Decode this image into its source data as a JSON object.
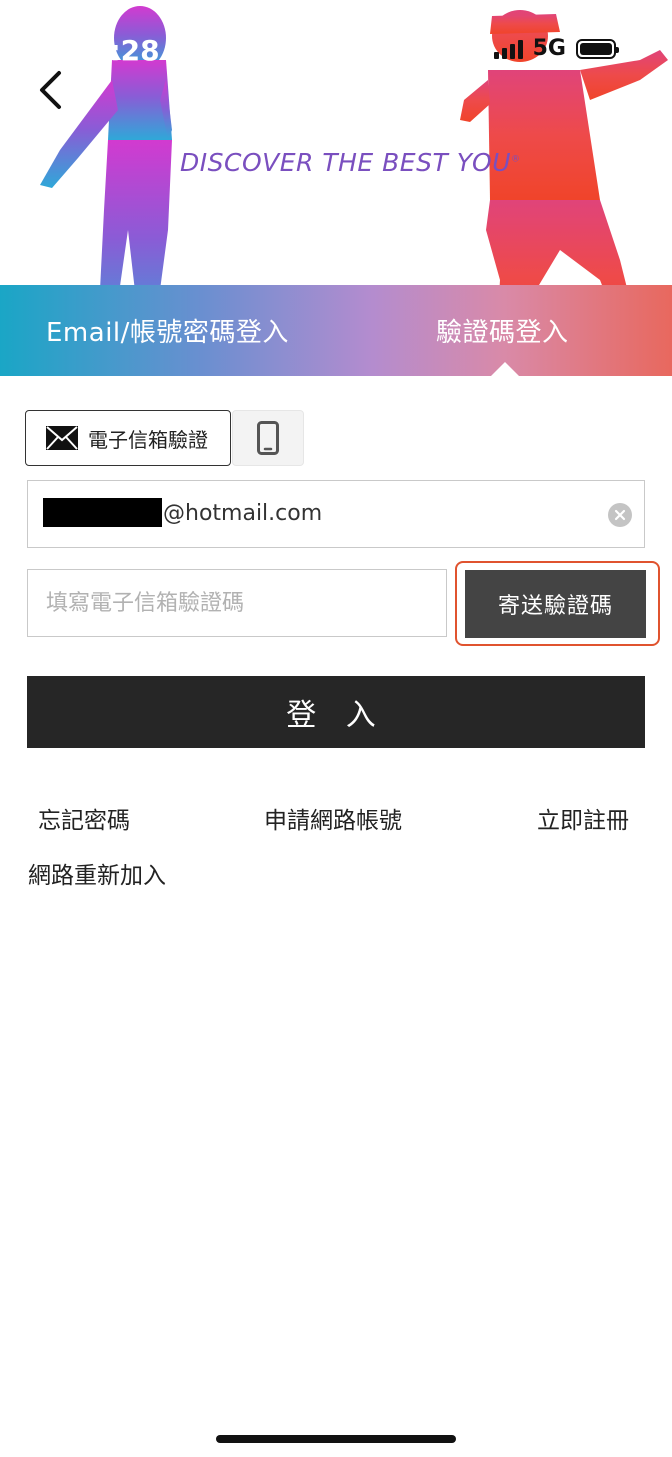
{
  "status_bar": {
    "time": "8:28",
    "network": "5G"
  },
  "header": {
    "slogan": "DISCOVER THE BEST YOU",
    "slogan_mark": "®",
    "tabs": [
      {
        "label": "Email/帳號密碼登入",
        "active": false
      },
      {
        "label": "驗證碼登入",
        "active": true
      }
    ]
  },
  "verify_method": {
    "email_label": "電子信箱驗證",
    "selected": "email"
  },
  "form": {
    "email_value_visible": "@hotmail.com",
    "code_placeholder": "填寫電子信箱驗證碼",
    "send_code_label": "寄送驗證碼",
    "login_label": "登 入"
  },
  "links": {
    "forgot_password": "忘記密碼",
    "apply_account": "申請網路帳號",
    "register_now": "立即註冊",
    "rejoin": "網路重新加入"
  },
  "icons": {
    "back": "chevron-left-icon",
    "email": "envelope-icon",
    "phone": "phone-icon",
    "clear": "clear-icon"
  },
  "colors": {
    "highlight": "#e0532f",
    "button_dark": "#262626",
    "send_button": "#444444",
    "slogan": "#7a4fbf"
  }
}
